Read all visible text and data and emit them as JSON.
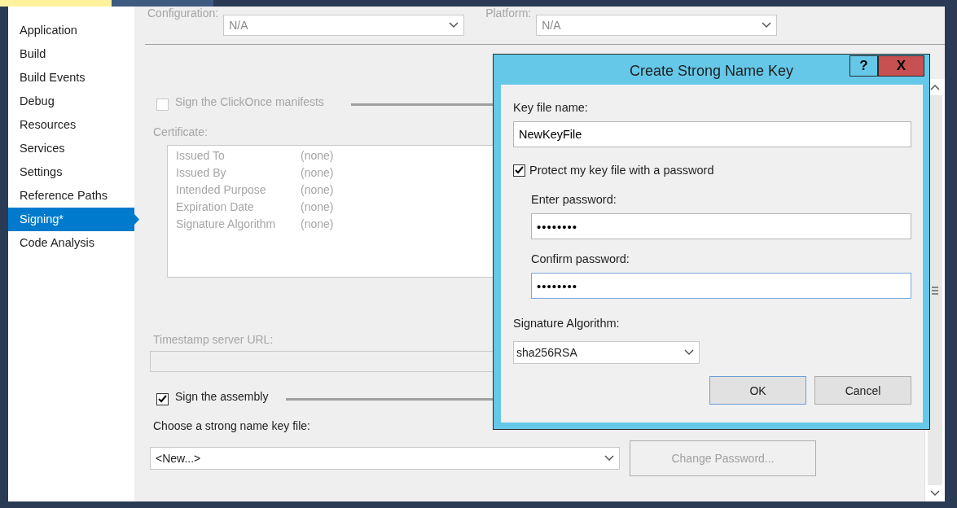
{
  "sidebar": {
    "items": [
      {
        "label": "Application",
        "selected": false
      },
      {
        "label": "Build",
        "selected": false
      },
      {
        "label": "Build Events",
        "selected": false
      },
      {
        "label": "Debug",
        "selected": false
      },
      {
        "label": "Resources",
        "selected": false
      },
      {
        "label": "Services",
        "selected": false
      },
      {
        "label": "Settings",
        "selected": false
      },
      {
        "label": "Reference Paths",
        "selected": false
      },
      {
        "label": "Signing*",
        "selected": true
      },
      {
        "label": "Code Analysis",
        "selected": false
      }
    ]
  },
  "configuration": {
    "label": "Configuration:",
    "value": "N/A",
    "disabled": true
  },
  "platform": {
    "label": "Platform:",
    "value": "N/A",
    "disabled": true
  },
  "clickonce": {
    "label": "Sign the ClickOnce manifests",
    "checked": false,
    "disabled": true
  },
  "certificate": {
    "label": "Certificate:",
    "disabled": true,
    "rows": [
      {
        "field": "Issued To",
        "value": "(none)"
      },
      {
        "field": "Issued By",
        "value": "(none)"
      },
      {
        "field": "Intended Purpose",
        "value": "(none)"
      },
      {
        "field": "Expiration Date",
        "value": "(none)"
      },
      {
        "field": "Signature Algorithm",
        "value": "(none)"
      }
    ]
  },
  "timestamp": {
    "label": "Timestamp server URL:",
    "disabled": true
  },
  "sign_assembly": {
    "label": "Sign the assembly",
    "checked": true,
    "disabled": false
  },
  "key_file": {
    "label": "Choose a strong name key file:",
    "value": "<New...>"
  },
  "change_password_button": {
    "label": "Change Password...",
    "disabled": true
  },
  "dialog": {
    "title": "Create Strong Name Key",
    "help": "?",
    "close": "X",
    "key_file": {
      "label": "Key file name:",
      "value": "NewKeyFile"
    },
    "protect": {
      "label": "Protect my key file with a password",
      "checked": true
    },
    "enter_password": {
      "label": "Enter password:",
      "value": "••••••••",
      "focused": false
    },
    "confirm_password": {
      "label": "Confirm password:",
      "value": "••••••••",
      "focused": true
    },
    "algorithm": {
      "label": "Signature Algorithm:",
      "value": "sha256RSA"
    },
    "buttons": [
      {
        "label": "OK",
        "default": true
      },
      {
        "label": "Cancel",
        "default": false
      }
    ]
  }
}
